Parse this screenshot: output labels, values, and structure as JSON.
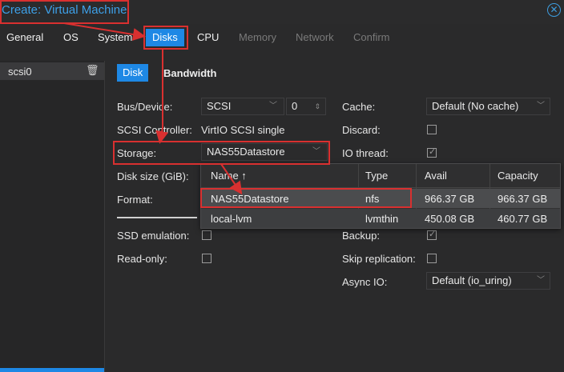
{
  "window": {
    "title": "Create: Virtual Machine",
    "close_icon": "close-circle-icon"
  },
  "tabs": [
    {
      "label": "General",
      "state": "normal"
    },
    {
      "label": "OS",
      "state": "normal"
    },
    {
      "label": "System",
      "state": "normal"
    },
    {
      "label": "Disks",
      "state": "active"
    },
    {
      "label": "CPU",
      "state": "normal"
    },
    {
      "label": "Memory",
      "state": "disabled"
    },
    {
      "label": "Network",
      "state": "disabled"
    },
    {
      "label": "Confirm",
      "state": "disabled"
    }
  ],
  "sidebar": {
    "items": [
      {
        "label": "scsi0",
        "icon": "trash-icon"
      }
    ]
  },
  "subtabs": [
    {
      "label": "Disk",
      "active": true
    },
    {
      "label": "Bandwidth",
      "active": false
    }
  ],
  "form_left": {
    "bus_device": {
      "label": "Bus/Device:",
      "value": "SCSI",
      "index": "0"
    },
    "scsi_controller": {
      "label": "SCSI Controller:",
      "value": "VirtIO SCSI single"
    },
    "storage": {
      "label": "Storage:",
      "value": "NAS55Datastore"
    },
    "disk_size": {
      "label": "Disk size (GiB):"
    },
    "format": {
      "label": "Format:"
    },
    "ssd_emulation": {
      "label": "SSD emulation:",
      "checked": false
    },
    "read_only": {
      "label": "Read-only:",
      "checked": false
    }
  },
  "form_right": {
    "cache": {
      "label": "Cache:",
      "value": "Default (No cache)"
    },
    "discard": {
      "label": "Discard:",
      "checked": false
    },
    "io_thread": {
      "label": "IO thread:",
      "checked": true
    },
    "backup": {
      "label": "Backup:",
      "checked": true
    },
    "skip_replication": {
      "label": "Skip replication:",
      "checked": false
    },
    "async_io": {
      "label": "Async IO:",
      "value": "Default (io_uring)"
    }
  },
  "storage_dropdown": {
    "columns": [
      "Name ↑",
      "Type",
      "Avail",
      "Capacity"
    ],
    "rows": [
      {
        "name": "NAS55Datastore",
        "type": "nfs",
        "avail": "966.37 GB",
        "capacity": "966.37 GB",
        "selected": true
      },
      {
        "name": "local-lvm",
        "type": "lvmthin",
        "avail": "450.08 GB",
        "capacity": "460.77 GB",
        "selected": false
      }
    ]
  },
  "colors": {
    "accent": "#1e88e5",
    "highlight": "#d93030",
    "background": "#2a2a2b"
  }
}
